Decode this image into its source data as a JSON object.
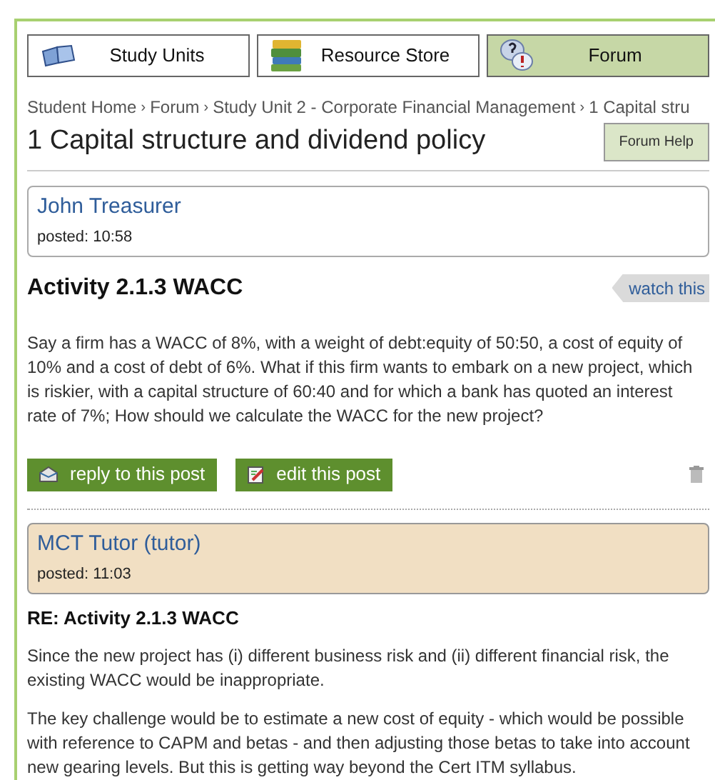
{
  "tabs": [
    {
      "label": "Study Units",
      "kind": "book",
      "selected": false
    },
    {
      "label": "Resource Store",
      "kind": "books",
      "selected": false
    },
    {
      "label": "Forum",
      "kind": "bubbles",
      "selected": true
    }
  ],
  "breadcrumb": {
    "separator": "›",
    "items": [
      "Student Home",
      "Forum",
      "Study Unit 2 - Corporate Financial Management",
      "1 Capital stru"
    ]
  },
  "page_title": "1 Capital structure and dividend policy",
  "help_button": "Forum Help",
  "posts": [
    {
      "author": "John Treasurer",
      "posted": "posted: 10:58",
      "tutor": false,
      "title": "Activity 2.1.3 WACC",
      "watch": "watch this",
      "paragraphs": [
        "Say a firm has a WACC of 8%, with a weight of debt:equity of 50:50, a cost of equity of 10% and a cost of debt of 6%. What if this firm wants to embark on a new project, which is riskier, with a capital structure of 60:40 and for which a bank has quoted an interest rate of 7%; How should we calculate the WACC for the new project?"
      ],
      "actions": [
        "reply to this post",
        "edit this post"
      ]
    },
    {
      "author": "MCT Tutor (tutor)",
      "posted": "posted: 11:03",
      "tutor": true,
      "title": "RE: Activity 2.1.3 WACC",
      "paragraphs": [
        "Since the new project has (i) different business risk and (ii) different financial risk, the existing WACC would be inappropriate.",
        "The key challenge would be to estimate a new cost of equity - which would be possible with reference to CAPM and betas - and then adjusting those betas to take into account new gearing levels. But this is getting way beyond the Cert ITM syllabus."
      ]
    }
  ]
}
